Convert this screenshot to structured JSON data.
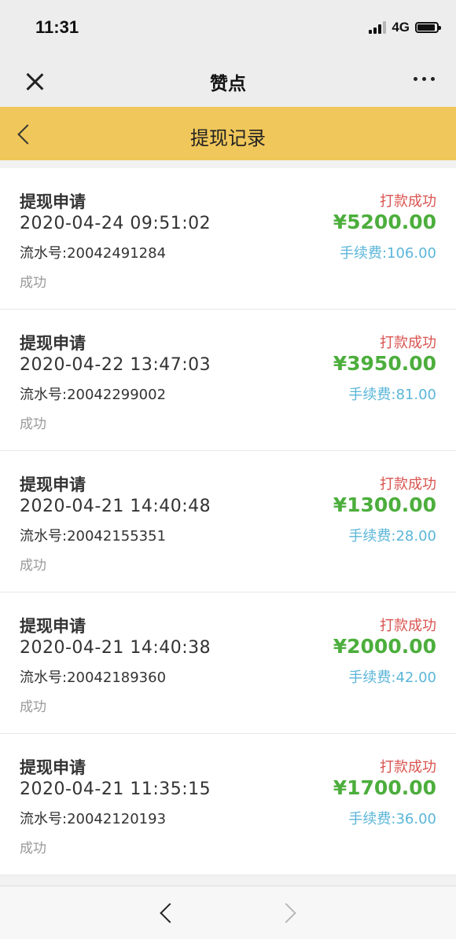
{
  "status_bar": {
    "time": "11:31",
    "network": "4G"
  },
  "nav": {
    "title": "赞点"
  },
  "header": {
    "title": "提现记录"
  },
  "records": [
    {
      "title": "提现申请",
      "time": "2020-04-24 09:51:02",
      "serial": "流水号:20042491284",
      "state": "成功",
      "status": "打款成功",
      "amount": "¥5200.00",
      "fee": "手续费:106.00"
    },
    {
      "title": "提现申请",
      "time": "2020-04-22 13:47:03",
      "serial": "流水号:20042299002",
      "state": "成功",
      "status": "打款成功",
      "amount": "¥3950.00",
      "fee": "手续费:81.00"
    },
    {
      "title": "提现申请",
      "time": "2020-04-21 14:40:48",
      "serial": "流水号:20042155351",
      "state": "成功",
      "status": "打款成功",
      "amount": "¥1300.00",
      "fee": "手续费:28.00"
    },
    {
      "title": "提现申请",
      "time": "2020-04-21 14:40:38",
      "serial": "流水号:20042189360",
      "state": "成功",
      "status": "打款成功",
      "amount": "¥2000.00",
      "fee": "手续费:42.00"
    },
    {
      "title": "提现申请",
      "time": "2020-04-21 11:35:15",
      "serial": "流水号:20042120193",
      "state": "成功",
      "status": "打款成功",
      "amount": "¥1700.00",
      "fee": "手续费:36.00"
    }
  ],
  "icons": {
    "close": "close-icon",
    "more": "more-icon",
    "back": "chevron-left-icon",
    "browser_back": "chevron-left-icon",
    "browser_forward": "chevron-right-icon"
  },
  "colors": {
    "header_bg": "#f0c75a",
    "status_red": "#d9534f",
    "amount_green": "#4cae3c",
    "fee_blue": "#5bb6d8"
  }
}
